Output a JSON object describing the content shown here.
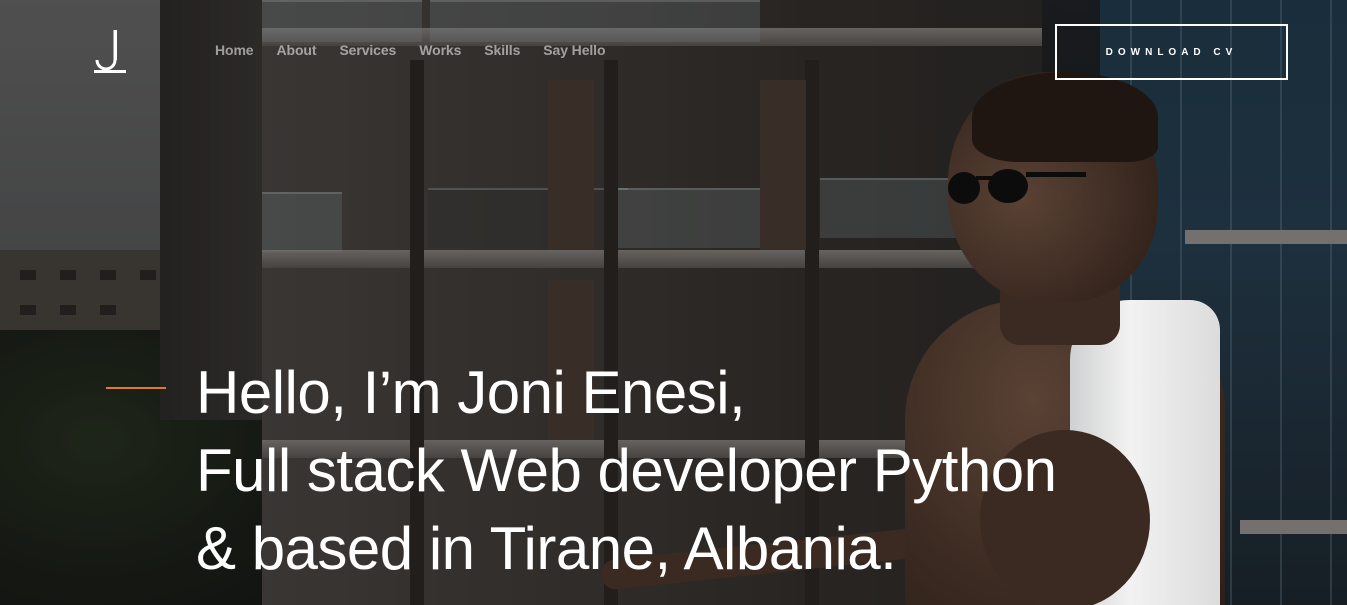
{
  "brand": {
    "logo_letter": "J"
  },
  "nav": {
    "items": [
      {
        "label": "Home"
      },
      {
        "label": "About"
      },
      {
        "label": "Services"
      },
      {
        "label": "Works"
      },
      {
        "label": "Skills"
      },
      {
        "label": "Say Hello"
      }
    ]
  },
  "header": {
    "cta_label": "DOWNLOAD CV"
  },
  "hero": {
    "lines": [
      "Hello, I’m Joni Enesi,",
      "Full stack Web developer Python",
      "& based in Tirane, Albania."
    ]
  },
  "colors": {
    "accent": "#e07a2b",
    "text": "#ffffff",
    "nav_text": "#ffffff"
  }
}
